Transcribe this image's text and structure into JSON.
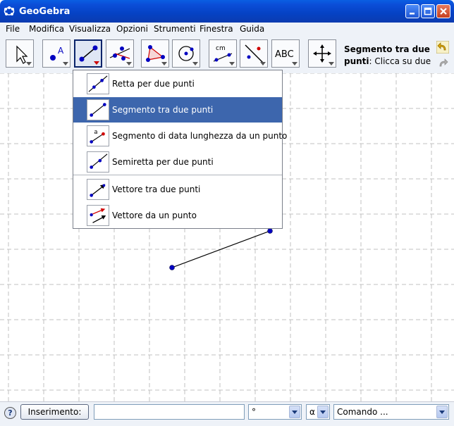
{
  "window": {
    "title": "GeoGebra",
    "app_icon": "geogebra-app-icon"
  },
  "window_controls": [
    "minimize-icon",
    "maximize-icon",
    "close-icon"
  ],
  "menu": [
    "File",
    "Modifica",
    "Visualizza",
    "Opzioni",
    "Strumenti",
    "Finestra",
    "Guida"
  ],
  "toolbar": {
    "tools": [
      {
        "name": "move-tool",
        "icon": "arrow-pointer-icon"
      },
      {
        "name": "point-tool",
        "icon": "point-a-icon"
      },
      {
        "name": "segment-tool",
        "icon": "segment-icon",
        "active": true
      },
      {
        "name": "perpendicular-tool",
        "icon": "perpendicular-line-icon"
      },
      {
        "name": "polygon-tool",
        "icon": "polygon-icon"
      },
      {
        "name": "circle-tool",
        "icon": "circle-icon"
      },
      {
        "name": "measure-tool",
        "icon": "angle-measure-icon"
      },
      {
        "name": "reflect-tool",
        "icon": "reflect-line-icon"
      },
      {
        "name": "text-tool",
        "icon": "text-abc-icon",
        "label": "ABC"
      },
      {
        "name": "move-view-tool",
        "icon": "move-view-icon"
      }
    ],
    "measure_label": "cm",
    "help_title": "Segmento tra due",
    "help_title_2": "punti",
    "help_text": ": Clicca su due ..."
  },
  "dropdown": {
    "items": [
      {
        "label": "Retta per due punti",
        "icon": "line-through-two-points-icon"
      },
      {
        "label": "Segmento tra due punti",
        "icon": "segment-two-points-icon",
        "selected": true
      },
      {
        "label": "Segmento di data lunghezza da un punto",
        "icon": "segment-given-length-icon",
        "icon_letter": "a"
      },
      {
        "label": "Semiretta per due punti",
        "icon": "ray-two-points-icon"
      },
      {
        "label": "Vettore tra due punti",
        "icon": "vector-two-points-icon"
      },
      {
        "label": "Vettore da un punto",
        "icon": "vector-from-point-icon"
      }
    ]
  },
  "input_bar": {
    "help_label": "?",
    "button_label": "Inserimento:",
    "input_value": "",
    "degree_symbol": "°",
    "greek_symbol": "α",
    "command_placeholder": "Comando ..."
  },
  "colors": {
    "point": "#0000c0",
    "selection": "#3d66ad",
    "title_bar": "#0b4ed8",
    "grid": "#c0c0c0"
  }
}
